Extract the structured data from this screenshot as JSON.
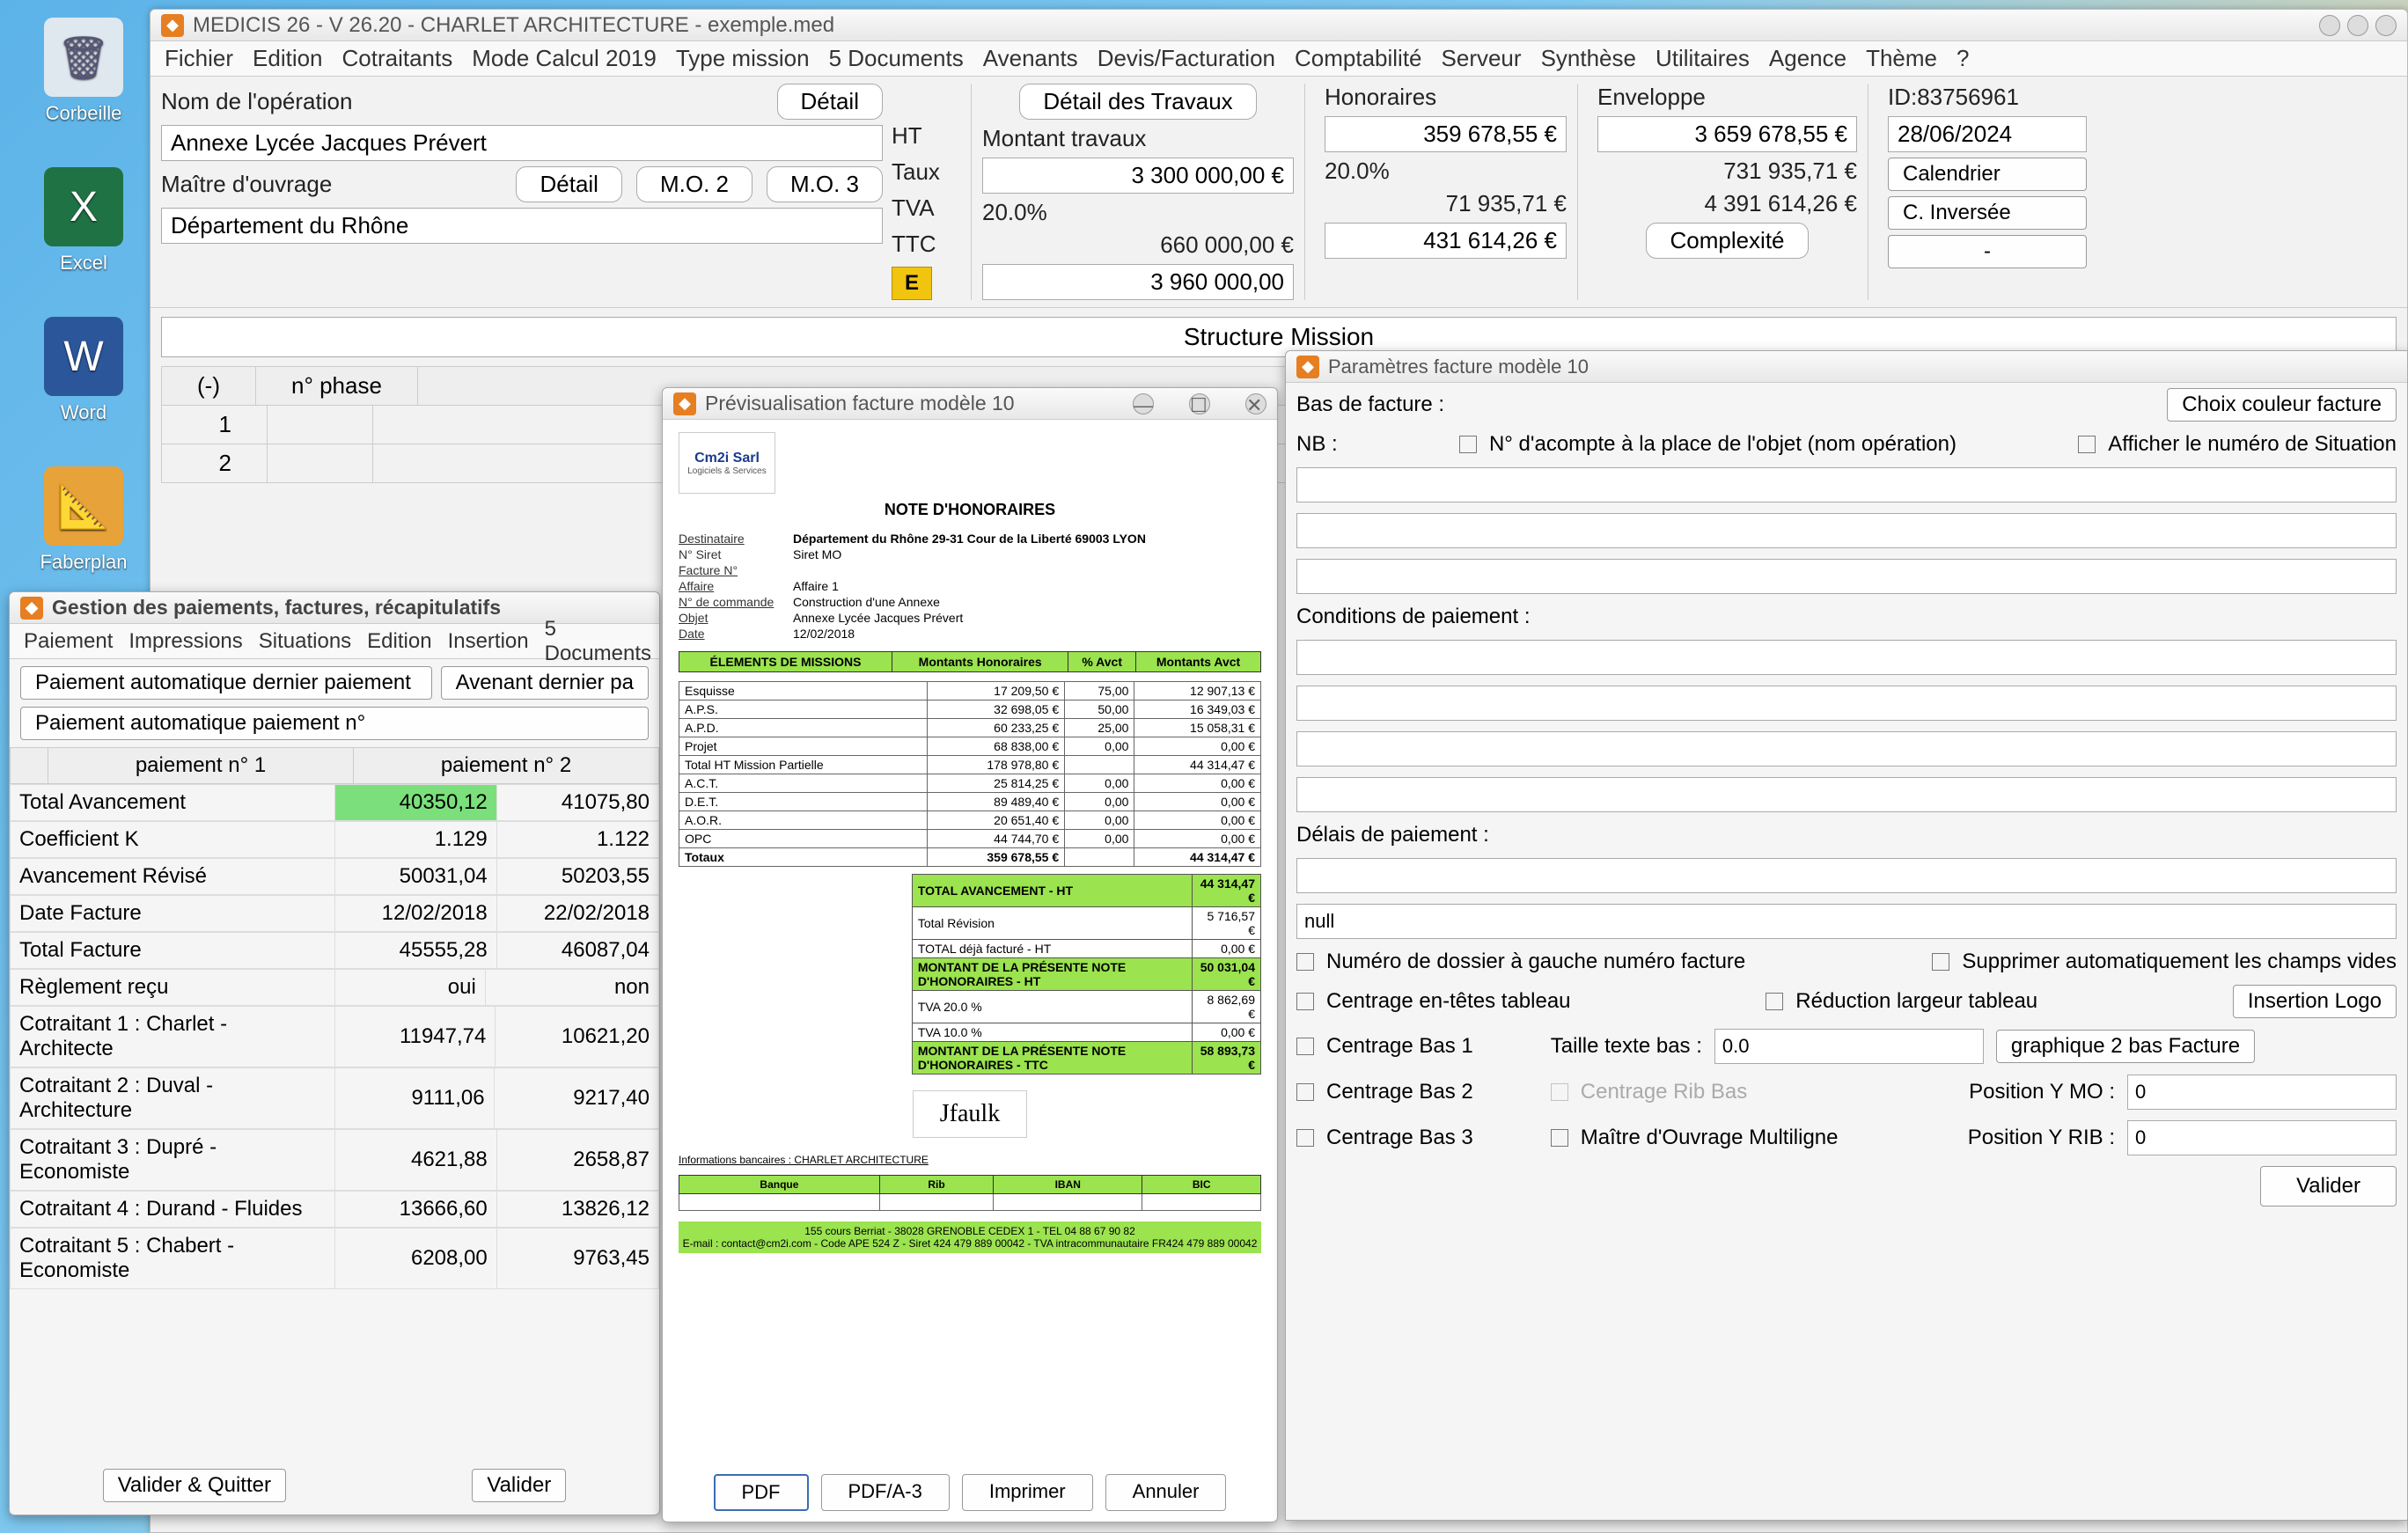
{
  "desktop": {
    "icons": [
      {
        "name": "corbeille",
        "label": "Corbeille",
        "color": "#dfe8ef",
        "glyph": "🗑"
      },
      {
        "name": "excel",
        "label": "Excel",
        "color": "#1f7244",
        "glyph": "X"
      },
      {
        "name": "word",
        "label": "Word",
        "color": "#2b579a",
        "glyph": "W"
      },
      {
        "name": "faberplan",
        "label": "Faberplan",
        "color": "#e8a23a",
        "glyph": "📐"
      }
    ]
  },
  "main": {
    "title": "MEDICIS 26  - V 26.20 - CHARLET ARCHITECTURE - exemple.med",
    "menu": [
      "Fichier",
      "Edition",
      "Cotraitants",
      "Mode Calcul 2019",
      "Type mission",
      "5 Documents",
      "Avenants",
      "Devis/Facturation",
      "Comptabilité",
      "Serveur",
      "Synthèse",
      "Utilitaires",
      "Agence",
      "Thème",
      "?"
    ],
    "op_label": "Nom de l'opération",
    "detail_btn": "Détail",
    "op_value": "Annexe Lycée Jacques Prévert",
    "mo_label": "Maître d'ouvrage",
    "mo_detail": "Détail",
    "mo2": "M.O. 2",
    "mo3": "M.O. 3",
    "mo_value": "Département du Rhône",
    "ht": "HT",
    "taux": "Taux",
    "tva": "TVA",
    "ttc": "TTC",
    "e": "E",
    "travaux": {
      "btn": "Détail des Travaux",
      "montant_lbl": "Montant travaux",
      "montant": "3 300 000,00 €",
      "taux": "20.0%",
      "tva": "660 000,00 €",
      "ttc": "3 960 000,00"
    },
    "honoraires": {
      "lbl": "Honoraires",
      "v1": "359 678,55 €",
      "pct": "20.0%",
      "v2": "71 935,71 €",
      "v3": "431 614,26 €"
    },
    "enveloppe": {
      "lbl": "Enveloppe",
      "v1": "3 659 678,55 €",
      "v2": "731 935,71 €",
      "v3": "4 391 614,26 €",
      "complex": "Complexité"
    },
    "rightcol": {
      "id": "ID:83756961",
      "date": "28/06/2024",
      "cal": "Calendrier",
      "cinv": "C. Inversée",
      "dash": "-"
    },
    "structure": "Structure Mission",
    "phase_hdr_minus": "(-)",
    "phase_hdr_num": "n° phase",
    "phase_rows": [
      "1",
      "2"
    ]
  },
  "payments": {
    "title": "Gestion des paiements, factures, récapitulatifs",
    "menu": [
      "Paiement",
      "Impressions",
      "Situations",
      "Edition",
      "Insertion",
      "5 Documents"
    ],
    "auto_last": "Paiement automatique dernier paiement",
    "avenant": "Avenant dernier pa",
    "auto_num": "Paiement automatique paiement n°",
    "col1": "paiement n° 1",
    "col2": "paiement n° 2",
    "rows": [
      {
        "l": "Total Avancement",
        "a": "40350,12",
        "b": "41075,80",
        "hl": true
      },
      {
        "l": "Coefficient K",
        "a": "1.129",
        "b": "1.122"
      },
      {
        "l": "Avancement Révisé",
        "a": "50031,04",
        "b": "50203,55"
      },
      {
        "l": "Date Facture",
        "a": "12/02/2018",
        "b": "22/02/2018"
      },
      {
        "l": "Total Facture",
        "a": "45555,28",
        "b": "46087,04"
      },
      {
        "l": "Règlement reçu",
        "a": "oui",
        "b": "non"
      },
      {
        "l": "Cotraitant 1 : Charlet - Architecte",
        "a": "11947,74",
        "b": "10621,20"
      },
      {
        "l": "Cotraitant 2 : Duval - Architecture",
        "a": "9111,06",
        "b": "9217,40"
      },
      {
        "l": "Cotraitant 3 : Dupré - Economiste",
        "a": "4621,88",
        "b": "2658,87"
      },
      {
        "l": "Cotraitant 4 : Durand - Fluides",
        "a": "13666,60",
        "b": "13826,12"
      },
      {
        "l": "Cotraitant 5 : Chabert - Economiste",
        "a": "6208,00",
        "b": "9763,45"
      }
    ],
    "valider_quitter": "Valider & Quitter",
    "valider": "Valider"
  },
  "preview": {
    "title": "Prévisualisation facture modèle 10",
    "note": "NOTE D'HONORAIRES",
    "logo_text": "Cm2i Sarl",
    "logo_sub": "Logiciels & Services",
    "lines": [
      {
        "l": "Destinataire",
        "v": "Département du Rhône  29-31 Cour de la Liberté 69003 LYON",
        "u": true,
        "b": true
      },
      {
        "l": "N° Siret",
        "v": "Siret MO"
      },
      {
        "l": "Facture N°",
        "v": "",
        "u": true
      },
      {
        "l": "Affaire",
        "v": "Affaire 1",
        "u": true
      },
      {
        "l": "N° de commande",
        "v": "Construction d'une Annexe",
        "u": true
      },
      {
        "l": "Objet",
        "v": "Annexe Lycée Jacques Prévert",
        "u": true
      },
      {
        "l": "Date",
        "v": "12/02/2018",
        "u": true
      }
    ],
    "th": [
      "ÉLEMENTS DE MISSIONS",
      "Montants Honoraires",
      "% Avct",
      "Montants Avct"
    ],
    "items": [
      {
        "n": "Esquisse",
        "h": "17 209,50 €",
        "p": "75,00",
        "a": "12 907,13 €"
      },
      {
        "n": "A.P.S.",
        "h": "32 698,05 €",
        "p": "50,00",
        "a": "16 349,03 €"
      },
      {
        "n": "A.P.D.",
        "h": "60 233,25 €",
        "p": "25,00",
        "a": "15 058,31 €"
      },
      {
        "n": "Projet",
        "h": "68 838,00 €",
        "p": "0,00",
        "a": "0,00 €"
      },
      {
        "n": "Total HT Mission Partielle",
        "h": "178 978,80 €",
        "p": "",
        "a": "44 314,47 €"
      },
      {
        "n": "A.C.T.",
        "h": "25 814,25 €",
        "p": "0,00",
        "a": "0,00 €"
      },
      {
        "n": "D.E.T.",
        "h": "89 489,40 €",
        "p": "0,00",
        "a": "0,00 €"
      },
      {
        "n": "A.O.R.",
        "h": "20 651,40 €",
        "p": "0,00",
        "a": "0,00 €"
      },
      {
        "n": "OPC",
        "h": "44 744,70 €",
        "p": "0,00",
        "a": "0,00 €"
      }
    ],
    "totaux": {
      "l": "Totaux",
      "h": "359 678,55 €",
      "a": "44 314,47 €"
    },
    "sum": [
      {
        "l": "TOTAL AVANCEMENT - HT",
        "v": "44 314,47 €",
        "g": true
      },
      {
        "l": "Total Révision",
        "v": "5 716,57 €"
      },
      {
        "l": "TOTAL déjà facturé - HT",
        "v": "0,00 €"
      },
      {
        "l": "MONTANT DE LA PRÉSENTE NOTE D'HONORAIRES - HT",
        "v": "50 031,04 €",
        "g": true
      },
      {
        "l": "TVA 20.0 %",
        "v": "8 862,69 €"
      },
      {
        "l": "TVA 10.0 %",
        "v": "0,00 €"
      },
      {
        "l": "MONTANT DE LA PRÉSENTE NOTE D'HONORAIRES - TTC",
        "v": "58 893,73 €",
        "g": true
      }
    ],
    "bank_title": "Informations bancaires : CHARLET ARCHITECTURE",
    "bank_hdrs": [
      "Banque",
      "Rib",
      "IBAN",
      "BIC"
    ],
    "footer1": "155 cours Berriat - 38028 GRENOBLE CEDEX 1 - TEL 04 88 67 90 82",
    "footer2": "E-mail : contact@cm2i.com - Code APE 524 Z - Siret 424 479 889 00042 - TVA intracommunautaire FR424 479 889 00042",
    "btns": [
      "PDF",
      "PDF/A-3",
      "Imprimer",
      "Annuler"
    ]
  },
  "params": {
    "title": "Paramètres facture modèle 10",
    "bas": "Bas de facture :",
    "choix": "Choix couleur facture",
    "nb": "NB :",
    "acompte": "N° d'acompte à la place de l'objet (nom opération)",
    "aff_sit": "Afficher le numéro de Situation",
    "cond": "Conditions de paiement :",
    "delais": "Délais de paiement :",
    "null": "null",
    "chk_dossier": "Numéro de dossier à gauche numéro facture",
    "chk_supp": "Supprimer automatiquement les champs vides",
    "chk_centrage_head": "Centrage en-têtes tableau",
    "chk_reduc": "Réduction largeur tableau",
    "ins_logo": "Insertion Logo",
    "chk_cb1": "Centrage Bas 1",
    "taille": "Taille texte bas :",
    "taille_v": "0.0",
    "graph": "graphique 2 bas Facture",
    "chk_cb2": "Centrage Bas 2",
    "chk_rib": "Centrage Rib Bas",
    "pos_mo": "Position Y MO :",
    "pos_mo_v": "0",
    "chk_cb3": "Centrage Bas 3",
    "chk_multi": "Maître d'Ouvrage Multiligne",
    "pos_rib": "Position Y RIB :",
    "pos_rib_v": "0",
    "valider": "Valider"
  }
}
